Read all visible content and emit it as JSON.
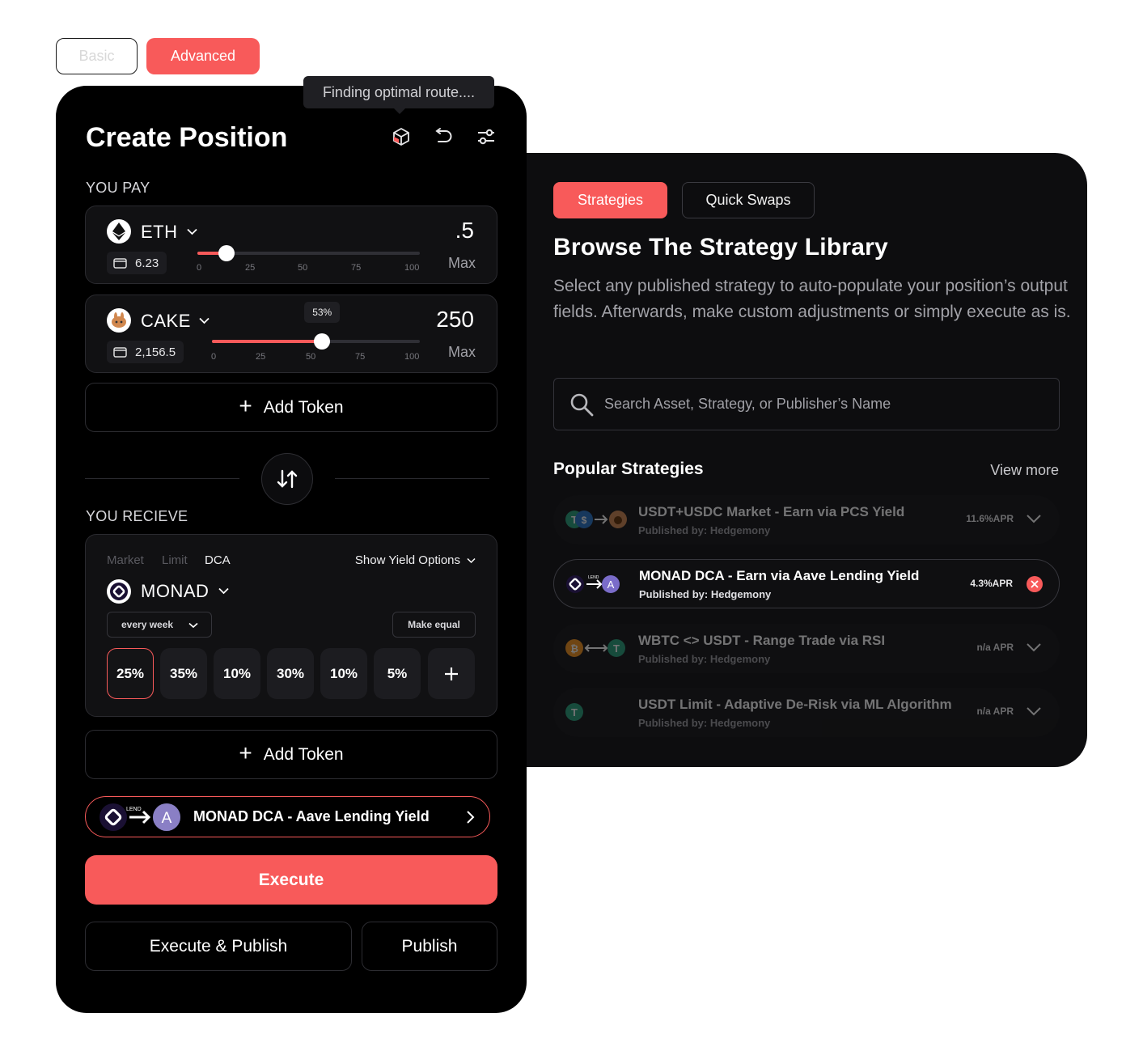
{
  "mode_tabs": {
    "basic": "Basic",
    "advanced": "Advanced"
  },
  "tooltip": "Finding optimal route....",
  "create": {
    "title": "Create Position",
    "you_pay_label": "YOU PAY",
    "you_receive_label": "YOU RECIEVE",
    "pay_tokens": [
      {
        "symbol": "ETH",
        "balance": "6.23",
        "amount": ".5",
        "max_label": "Max",
        "slider_percent": 13,
        "ticks": [
          "0",
          "25",
          "50",
          "75",
          "100"
        ]
      },
      {
        "symbol": "CAKE",
        "balance": "2,156.5",
        "amount": "250",
        "max_label": "Max",
        "slider_percent": 53,
        "bubble": "53%",
        "ticks": [
          "0",
          "25",
          "50",
          "75",
          "100"
        ]
      }
    ],
    "add_token_label": "Add Token",
    "order_tabs": [
      "Market",
      "Limit",
      "DCA"
    ],
    "active_order_tab": "DCA",
    "show_yield_options": "Show Yield Options",
    "receive_token": {
      "symbol": "MONAD"
    },
    "frequency": "every week",
    "make_equal": "Make equal",
    "percent_buttons": [
      "25%",
      "35%",
      "10%",
      "30%",
      "10%",
      "5%"
    ],
    "strategy_pill": {
      "name": "MONAD DCA - Aave Lending Yield",
      "tag": "LEND"
    },
    "execute": "Execute",
    "execute_publish": "Execute & Publish",
    "publish": "Publish"
  },
  "library": {
    "tabs": {
      "strategies": "Strategies",
      "quick_swaps": "Quick Swaps"
    },
    "title": "Browse The Strategy Library",
    "description": "Select any published strategy to auto-populate your position’s output fields.  Afterwards, make custom adjustments or simply execute as is.",
    "search_placeholder": "Search Asset, Strategy, or Publisher’s Name",
    "popular_title": "Popular Strategies",
    "view_more": "View more",
    "strategies": [
      {
        "name": "USDT+USDC Market - Earn via PCS Yield",
        "publisher": "Published by: Hedgemony",
        "apr": "11.6%APR",
        "state": "dim"
      },
      {
        "name": "MONAD DCA - Earn via Aave Lending Yield",
        "publisher": "Published by: Hedgemony",
        "apr": "4.3%APR",
        "state": "active"
      },
      {
        "name": "WBTC <> USDT - Range Trade via RSI",
        "publisher": "Published by: Hedgemony",
        "apr": "n/a APR",
        "state": "dim"
      },
      {
        "name": "USDT Limit - Adaptive De-Risk via ML Algorithm",
        "publisher": "Published by: Hedgemony",
        "apr": "n/a APR",
        "state": "dim"
      }
    ]
  },
  "colors": {
    "accent": "#f85a5a",
    "panel": "#000000",
    "panel_alt": "#0d0d0f"
  }
}
